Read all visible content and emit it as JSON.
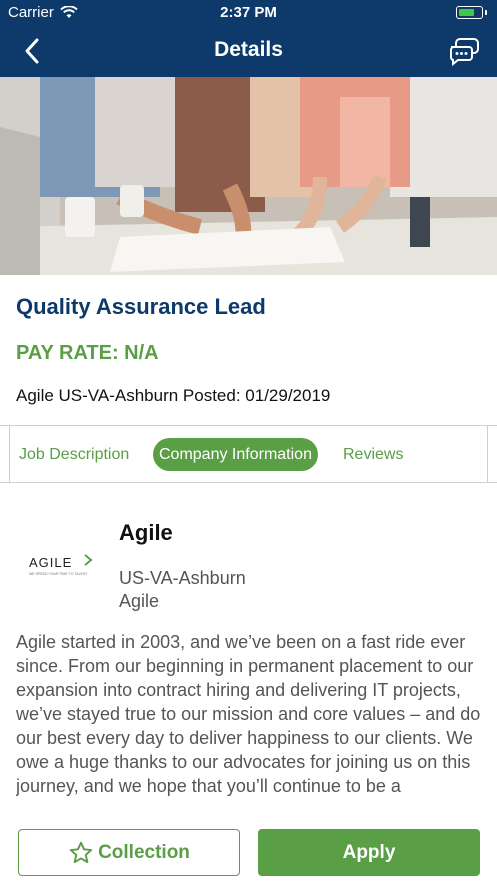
{
  "status_bar": {
    "carrier": "Carrier",
    "time": "2:37 PM",
    "battery_level": 0.75,
    "battery_color": "#3ec94b"
  },
  "nav": {
    "title": "Details",
    "back_icon": "chevron-left-icon",
    "chat_icon": "chat-bubbles-icon"
  },
  "hero": {
    "image": "team-working-at-table"
  },
  "job": {
    "title": "Quality Assurance Lead",
    "pay_rate": "PAY RATE: N/A",
    "meta": "Agile US-VA-Ashburn Posted: 01/29/2019"
  },
  "tabs": [
    {
      "label": "Job Description",
      "active": false
    },
    {
      "label": "Company Information",
      "active": true
    },
    {
      "label": "Reviews",
      "active": false
    }
  ],
  "company": {
    "logo_text": "AGILE",
    "logo_tagline": "WE SPEED YOUR TIME TO TALENT",
    "name": "Agile",
    "location": "US-VA-Ashburn",
    "city": "Agile",
    "description": "Agile started in 2003, and we’ve been on a fast ride ever since. From our beginning in permanent placement to our expansion into contract hiring and delivering IT projects, we’ve stayed true to our mission and core values – and do our best every day to deliver happiness to our clients. We owe a huge thanks to our advocates for joining us on this journey, and we hope that you’ll continue to be a"
  },
  "buttons": {
    "collection": "Collection",
    "apply": "Apply"
  },
  "colors": {
    "navy": "#0d3a6b",
    "green": "#5a9e46"
  }
}
